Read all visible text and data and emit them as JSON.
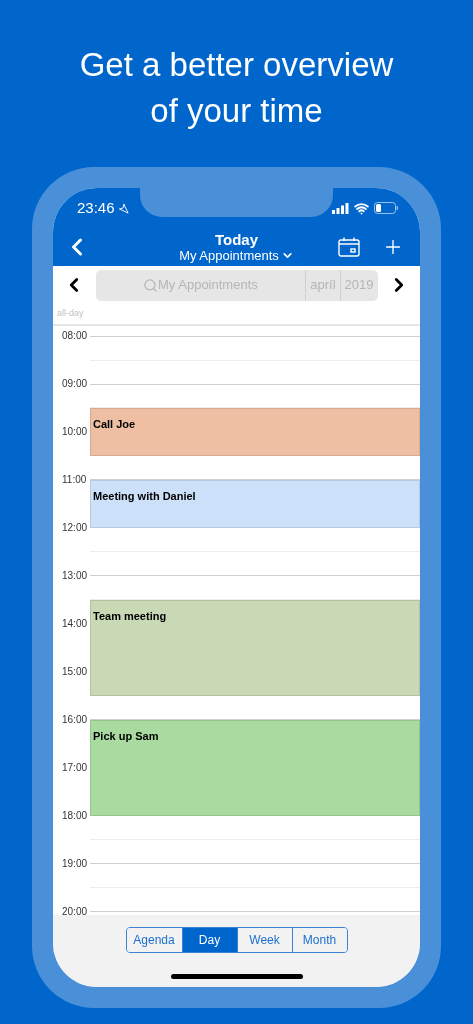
{
  "headline": "Get a better overview of your time",
  "status_bar": {
    "time": "23:46"
  },
  "header": {
    "title": "Today",
    "subtitle": "My Appointments"
  },
  "nav": {
    "search_placeholder": "My Appointments",
    "month": "apríl",
    "year": "2019"
  },
  "all_day_label": "all-day",
  "hours": [
    {
      "label": "08:00",
      "halves": [
        {
          "busy": false
        },
        {
          "busy": false
        }
      ]
    },
    {
      "label": "09:00",
      "halves": [
        {
          "busy": false
        },
        {
          "busy": true,
          "title": "Call Joe",
          "color": "#efbfa3"
        }
      ]
    },
    {
      "label": "10:00",
      "halves": [
        {
          "busy": true
        },
        {
          "busy": false
        }
      ]
    },
    {
      "label": "11:00",
      "halves": [
        {
          "busy": true,
          "title": "Meeting with Daniel",
          "color": "#cde0fa"
        },
        {
          "busy": true
        }
      ]
    },
    {
      "label": "12:00",
      "halves": [
        {
          "busy": false
        },
        {
          "busy": false
        }
      ]
    },
    {
      "label": "13:00",
      "halves": [
        {
          "busy": false
        },
        {
          "busy": true,
          "title": "Team meeting",
          "color": "#c9d9b6"
        }
      ]
    },
    {
      "label": "14:00",
      "halves": [
        {
          "busy": true
        },
        {
          "busy": true
        }
      ]
    },
    {
      "label": "15:00",
      "halves": [
        {
          "busy": true
        },
        {
          "busy": false
        }
      ]
    },
    {
      "label": "16:00",
      "halves": [
        {
          "busy": true,
          "title": "Pick up Sam",
          "color": "#a9da9f"
        },
        {
          "busy": true
        }
      ]
    },
    {
      "label": "17:00",
      "halves": [
        {
          "busy": true
        },
        {
          "busy": true
        }
      ]
    },
    {
      "label": "18:00",
      "halves": [
        {
          "busy": false
        },
        {
          "busy": false
        }
      ]
    },
    {
      "label": "19:00",
      "halves": [
        {
          "busy": false
        },
        {
          "busy": false
        }
      ]
    },
    {
      "label": "20:00"
    }
  ],
  "views": [
    {
      "label": "Agenda",
      "selected": false
    },
    {
      "label": "Day",
      "selected": true
    },
    {
      "label": "Week",
      "selected": false
    },
    {
      "label": "Month",
      "selected": false
    }
  ]
}
